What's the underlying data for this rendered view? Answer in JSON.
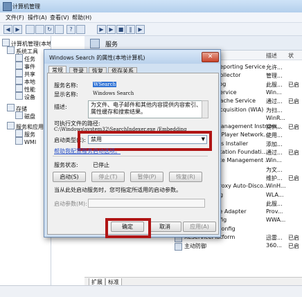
{
  "window": {
    "title": "计算机管理"
  },
  "menu": [
    "文件(F)",
    "操作(A)",
    "查看(V)",
    "帮助(H)"
  ],
  "tree": {
    "root": "计算机管理(本地)",
    "items": [
      "系统工具",
      "任务",
      "事件",
      "共享",
      "本地",
      "性能",
      "设备",
      "存储",
      "磁盘",
      "服务和应用",
      "服务",
      "WMI"
    ]
  },
  "services_panel": {
    "header": "服务",
    "columns": [
      "描述",
      "状"
    ],
    "rows": [
      {
        "name": "Reporting Service",
        "desc": "允许...",
        "status": ""
      },
      {
        "name": "Collector",
        "desc": "管理...",
        "status": ""
      },
      {
        "name": "Log",
        "desc": "此服...",
        "status": "已启"
      },
      {
        "name": "Service",
        "desc": "Win...",
        "status": ""
      },
      {
        "name": "Cache Service",
        "desc": "通过...",
        "status": "已启"
      },
      {
        "name": "Acquisition (WIA)",
        "desc": "为扫...",
        "status": ""
      },
      {
        "name": "",
        "desc": "WinR...",
        "status": ""
      },
      {
        "name": "Management Instrum...",
        "desc": "提供...",
        "status": "已启"
      },
      {
        "name": "a Player Network...",
        "desc": "使用...",
        "status": ""
      },
      {
        "name": "les Installer",
        "desc": "添加...",
        "status": ""
      },
      {
        "name": "ntation Foundati...",
        "desc": "通过...",
        "status": "已启"
      },
      {
        "name": "ote Management ...",
        "desc": "Win...",
        "status": ""
      },
      {
        "name": "",
        "desc": "为文...",
        "status": ""
      },
      {
        "name": "",
        "desc": "维护...",
        "status": "已启"
      },
      {
        "name": "Proxy Auto-Disco...",
        "desc": "WinH...",
        "status": ""
      },
      {
        "name": "fig",
        "desc": "WLA...",
        "status": ""
      },
      {
        "name": "",
        "desc": "此服...",
        "status": ""
      },
      {
        "name": "ce Adapter",
        "desc": "Prov...",
        "status": ""
      },
      {
        "name": "nfig",
        "desc": "WWA...",
        "status": ""
      },
      {
        "name": "WWAN AutoConfig",
        "desc": "",
        "status": ""
      },
      {
        "name": "XLServicePlatform",
        "desc": "迅雷...",
        "status": "已启"
      },
      {
        "name": "主动防御",
        "desc": "360...",
        "status": "已启"
      }
    ],
    "tabs": [
      "扩展",
      "标准"
    ]
  },
  "dialog": {
    "title": "Windows Search 的属性(本地计算机)",
    "tabs": [
      "常规",
      "登录",
      "恢复",
      "依存关系"
    ],
    "service_name_label": "服务名称:",
    "service_name_value": "WSearch",
    "display_name_label": "显示名称:",
    "display_name_value": "Windows Search",
    "desc_label": "描述:",
    "desc_value": "为文件、电子邮件和其他内容提供内容索引、属性缓存和搜索结果。",
    "path_label": "可执行文件的路径:",
    "path_value": "C:\\Windows\\system32\\SearchIndexer.exe /Embedding",
    "startup_label": "启动类型(E):",
    "startup_value": "禁用",
    "help_link": "帮助我配置服务启动选项。",
    "status_label": "服务状态:",
    "status_value": "已停止",
    "buttons": {
      "start": "启动(S)",
      "stop": "停止(T)",
      "pause": "暂停(P)",
      "resume": "恢复(R)"
    },
    "hint": "当从此处启动服务时，您可指定所适用的启动参数。",
    "param_label": "启动参数(M):",
    "ok": "确定",
    "cancel": "取消",
    "apply": "应用(A)"
  },
  "colors": {
    "highlight": "#b01515",
    "dialog_frame": "#d1e1f2"
  }
}
